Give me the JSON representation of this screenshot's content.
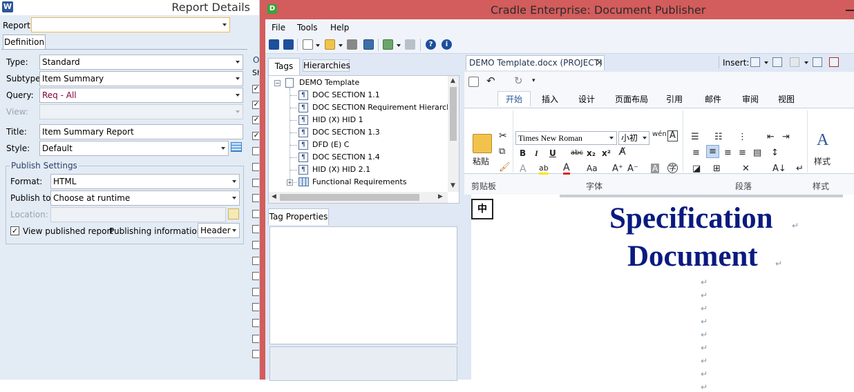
{
  "report_details": {
    "title": "Report Details",
    "report_label": "Report:",
    "report_value": "",
    "tab_definition": "Definition",
    "type_label": "Type:",
    "type_value": "Standard",
    "subtype_label": "Subtype:",
    "subtype_value": "Item Summary",
    "query_label": "Query:",
    "query_value": "Req - All",
    "view_label": "View:",
    "view_value": "",
    "title_label": "Title:",
    "title_value": "Item Summary Report",
    "style_label": "Style:",
    "style_value": "Default",
    "publish_settings": "Publish Settings",
    "format_label": "Format:",
    "format_value": "HTML",
    "publish_to_label": "Publish to:",
    "publish_to_value": "Choose at runtime",
    "location_label": "Location:",
    "location_value": "",
    "view_published_label": "View published report",
    "view_published_checked": true,
    "publishing_info_label": "Publishing information:",
    "publishing_info_value": "Header",
    "side_col_o": "O",
    "side_col_sh": "Sh",
    "side_checks": [
      true,
      true,
      true,
      true,
      false,
      false,
      false,
      false,
      false,
      false,
      false,
      false,
      false,
      false,
      false,
      false,
      false,
      false
    ]
  },
  "cradle": {
    "title": "Cradle Enterprise: Document Publisher",
    "menu": [
      "File",
      "Tools",
      "Help"
    ],
    "tags_tab": "Tags",
    "hierarchies_tab": "Hierarchies",
    "tree_root": "DEMO Template",
    "tree_items": [
      {
        "label": "DOC SECTION 1.1",
        "icon": "paragraph-icon"
      },
      {
        "label": "DOC SECTION Requirement Hierarchy",
        "icon": "paragraph-icon"
      },
      {
        "label": "HID (X) HID 1",
        "icon": "paragraph-icon"
      },
      {
        "label": "DOC SECTION 1.3",
        "icon": "paragraph-icon"
      },
      {
        "label": "DFD (E) C",
        "icon": "paragraph-icon"
      },
      {
        "label": "DOC SECTION 1.4",
        "icon": "paragraph-icon"
      },
      {
        "label": "HID (X) HID 2.1",
        "icon": "paragraph-icon"
      },
      {
        "label": "Functional Requirements",
        "icon": "grid-icon"
      }
    ],
    "tag_properties_tab": "Tag Properties",
    "doc_tab": "DEMO Template.docx (PROJECT)",
    "insert_label": "Insert:",
    "ribbon_tabs": [
      "开始",
      "插入",
      "设计",
      "页面布局",
      "引用",
      "邮件",
      "审阅",
      "视图"
    ],
    "ribbon_active": "开始",
    "font_name": "Times New Roman",
    "font_size": "小初",
    "paste_label": "粘贴",
    "styles_label": "样式",
    "groups": [
      "剪贴板",
      "字体",
      "段落",
      "样式"
    ],
    "ime_indicator": "中",
    "doc_title_line1": "Specification",
    "doc_title_line2": "Document",
    "font_buttons": {
      "bold": "B",
      "italic": "I",
      "underline": "U",
      "strike": "abc",
      "sub": "x₂",
      "sup": "x²",
      "case": "Aa"
    }
  },
  "colors": {
    "cradle_titlebar": "#d35c5c",
    "panel_bg": "#dfe8f4",
    "report_bg": "#e3ebf5",
    "doc_title": "#0a1a80",
    "query_text": "#800040"
  }
}
